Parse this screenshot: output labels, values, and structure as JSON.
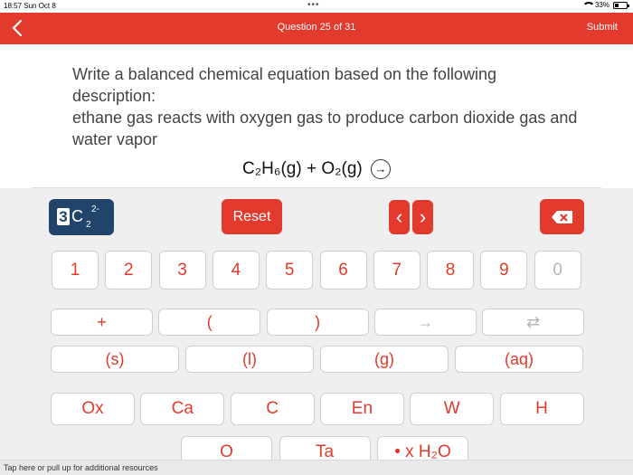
{
  "status": {
    "time": "18:57  Sun Oct 8",
    "battery": "33%",
    "battery_level": 0.33
  },
  "header": {
    "title": "Question 25 of 31",
    "submit": "Submit"
  },
  "question": {
    "line1": "Write a balanced chemical equation based on the following description:",
    "line2": "ethane gas reacts with oxygen gas to produce carbon dioxide gas and water vapor"
  },
  "equation": {
    "text": "C₂H₆(g) + O₂(g)",
    "arrow": "→"
  },
  "toolbar": {
    "charge_main": "C",
    "charge_sub": "2",
    "charge_sup": "2-",
    "charge_coef": "3",
    "reset": "Reset",
    "prev": "‹",
    "next": "›",
    "delete": "✕"
  },
  "digits": [
    "1",
    "2",
    "3",
    "4",
    "5",
    "6",
    "7",
    "8",
    "9",
    "0"
  ],
  "operators": [
    "+",
    "(",
    ")",
    "→",
    "⇄"
  ],
  "states": [
    "(s)",
    "(l)",
    "(g)",
    "(aq)"
  ],
  "elements": [
    "Ox",
    "Ca",
    "C",
    "En",
    "W",
    "H"
  ],
  "partial_row": [
    "O",
    "Ta",
    "• x H₂O"
  ],
  "footer": {
    "hint": "Tap here or pull up for additional resources"
  },
  "colors": {
    "accent": "#e23a2c",
    "navy": "#20446a",
    "keyboard_bg": "#efefef"
  }
}
